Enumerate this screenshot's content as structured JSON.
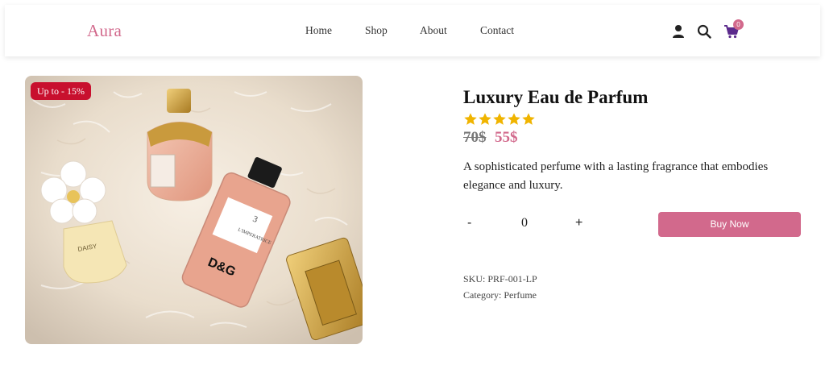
{
  "header": {
    "logo": "Aura",
    "nav": [
      "Home",
      "Shop",
      "About",
      "Contact"
    ],
    "cart_count": "0",
    "icons": [
      "user-icon",
      "search-icon",
      "cart-icon"
    ]
  },
  "product": {
    "badge": "Up to - 15%",
    "title": "Luxury Eau de Parfum",
    "rating": 5,
    "rating_max": 5,
    "price_old": "70$",
    "price_new": "55$",
    "description": "A sophisticated perfume with a lasting fragrance that embodies elegance and luxury.",
    "quantity": {
      "minus": "-",
      "value": "0",
      "plus": "+"
    },
    "buy_label": "Buy Now",
    "sku": "SKU: PRF-001-LP",
    "category": "Category: Perfume",
    "image_label_1": "3",
    "image_label_2": "L'IMPERATRICE",
    "image_label_3": "D&G",
    "image_label_4": "DAISY"
  },
  "colors": {
    "accent": "#d2698c",
    "badge": "#c8102e",
    "star": "#f0b400"
  }
}
